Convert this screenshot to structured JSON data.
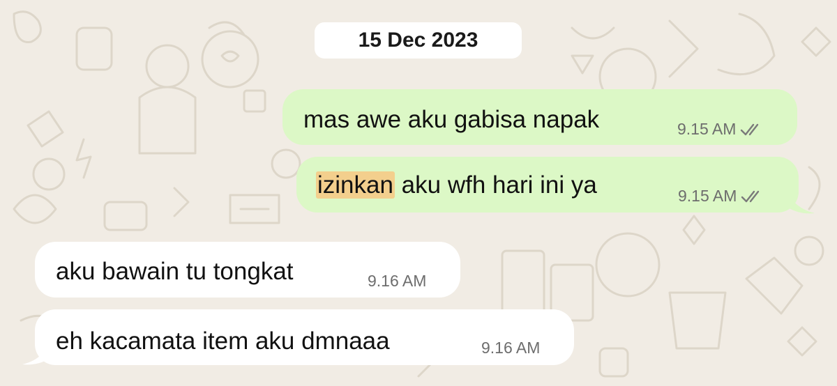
{
  "date_separator": "15 Dec 2023",
  "messages": [
    {
      "direction": "outgoing",
      "text": "mas awe aku gabisa napak",
      "time": "9.15 AM",
      "status": "read-double-tick"
    },
    {
      "direction": "outgoing",
      "highlight": "izinkan",
      "text": " aku wfh hari ini ya",
      "time": "9.15 AM",
      "status": "read-double-tick"
    },
    {
      "direction": "incoming",
      "text": "aku bawain tu tongkat",
      "time": "9.16 AM"
    },
    {
      "direction": "incoming",
      "text": "eh kacamata item aku dmnaaa",
      "time": "9.16 AM"
    }
  ],
  "colors": {
    "background": "#f1ece4",
    "outgoing_bubble": "#dcf8c6",
    "incoming_bubble": "#ffffff",
    "highlight": "#f3cf8d",
    "timestamp": "#6d6d6d"
  },
  "icons": [
    "double-check-icon",
    "chat-doodle-wallpaper"
  ]
}
